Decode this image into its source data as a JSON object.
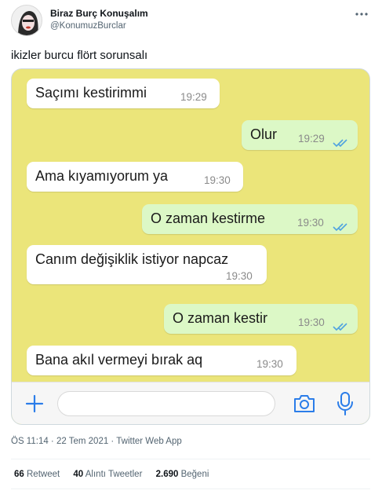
{
  "tweet": {
    "author_name": "Biraz Burç Konuşalım",
    "author_handle": "@KonumuzBurclar",
    "more_icon": "ellipsis-icon",
    "text": "ikizler burcu flört sorunsalı",
    "timestamp": "ÖS 11:14 · 22 Tem 2021 · Twitter Web App",
    "stats": {
      "retweets_count": "66",
      "retweets_label": "Retweet",
      "quotes_count": "40",
      "quotes_label": "Alıntı Tweetler",
      "likes_count": "2.690",
      "likes_label": "Beğeni"
    }
  },
  "chat": {
    "background_color": "#ebe57a",
    "incoming_color": "#ffffff",
    "outgoing_color": "#dcf8c6",
    "read_tick_color": "#4fa3e0",
    "messages": [
      {
        "direction": "incoming",
        "text": "Saçımı kestirimmi",
        "time": "19:29"
      },
      {
        "direction": "outgoing",
        "text": "Olur",
        "time": "19:29",
        "status": "read"
      },
      {
        "direction": "incoming",
        "text": "Ama kıyamıyorum ya",
        "time": "19:30"
      },
      {
        "direction": "outgoing",
        "text": "O zaman kestirme",
        "time": "19:30",
        "status": "read"
      },
      {
        "direction": "incoming",
        "text": "Canım değişiklik istiyor napcaz",
        "time": "19:30"
      },
      {
        "direction": "outgoing",
        "text": "O zaman kestir",
        "time": "19:30",
        "status": "read"
      },
      {
        "direction": "incoming",
        "text": "Bana akıl vermeyi bırak aq",
        "time": "19:30"
      }
    ],
    "input": {
      "placeholder": "",
      "accent_color": "#2b7de9",
      "icons": [
        "plus-icon",
        "camera-icon",
        "microphone-icon"
      ]
    }
  }
}
